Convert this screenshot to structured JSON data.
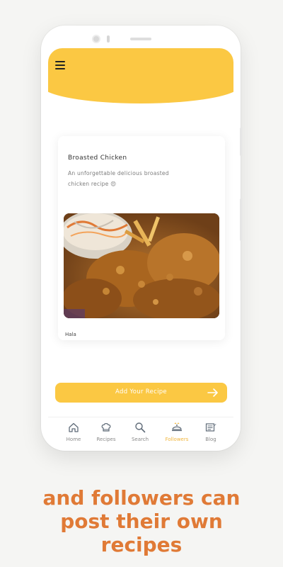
{
  "app": {
    "header": {
      "menu_icon": "hamburger-menu-icon",
      "accent_color": "#fbc843"
    },
    "card": {
      "title": "Broasted Chicken",
      "description": "An unforgettable delicious broasted chicken recipe 😍",
      "image": "fried-chicken-photo",
      "author": "Hala"
    },
    "add_button": {
      "label": "Add Your Recipe",
      "icon": "arrow-right-icon"
    },
    "nav": [
      {
        "label": "Home",
        "icon": "home-icon"
      },
      {
        "label": "Recipes",
        "icon": "chef-hat-icon"
      },
      {
        "label": "Search",
        "icon": "search-icon"
      },
      {
        "label": "Followers",
        "icon": "serving-dish-icon",
        "active": true
      },
      {
        "label": "Blog",
        "icon": "blog-icon"
      }
    ]
  },
  "tagline": {
    "line1": "and followers can",
    "line2": "post their own",
    "line3": "recipes",
    "color": "#e07a36"
  }
}
